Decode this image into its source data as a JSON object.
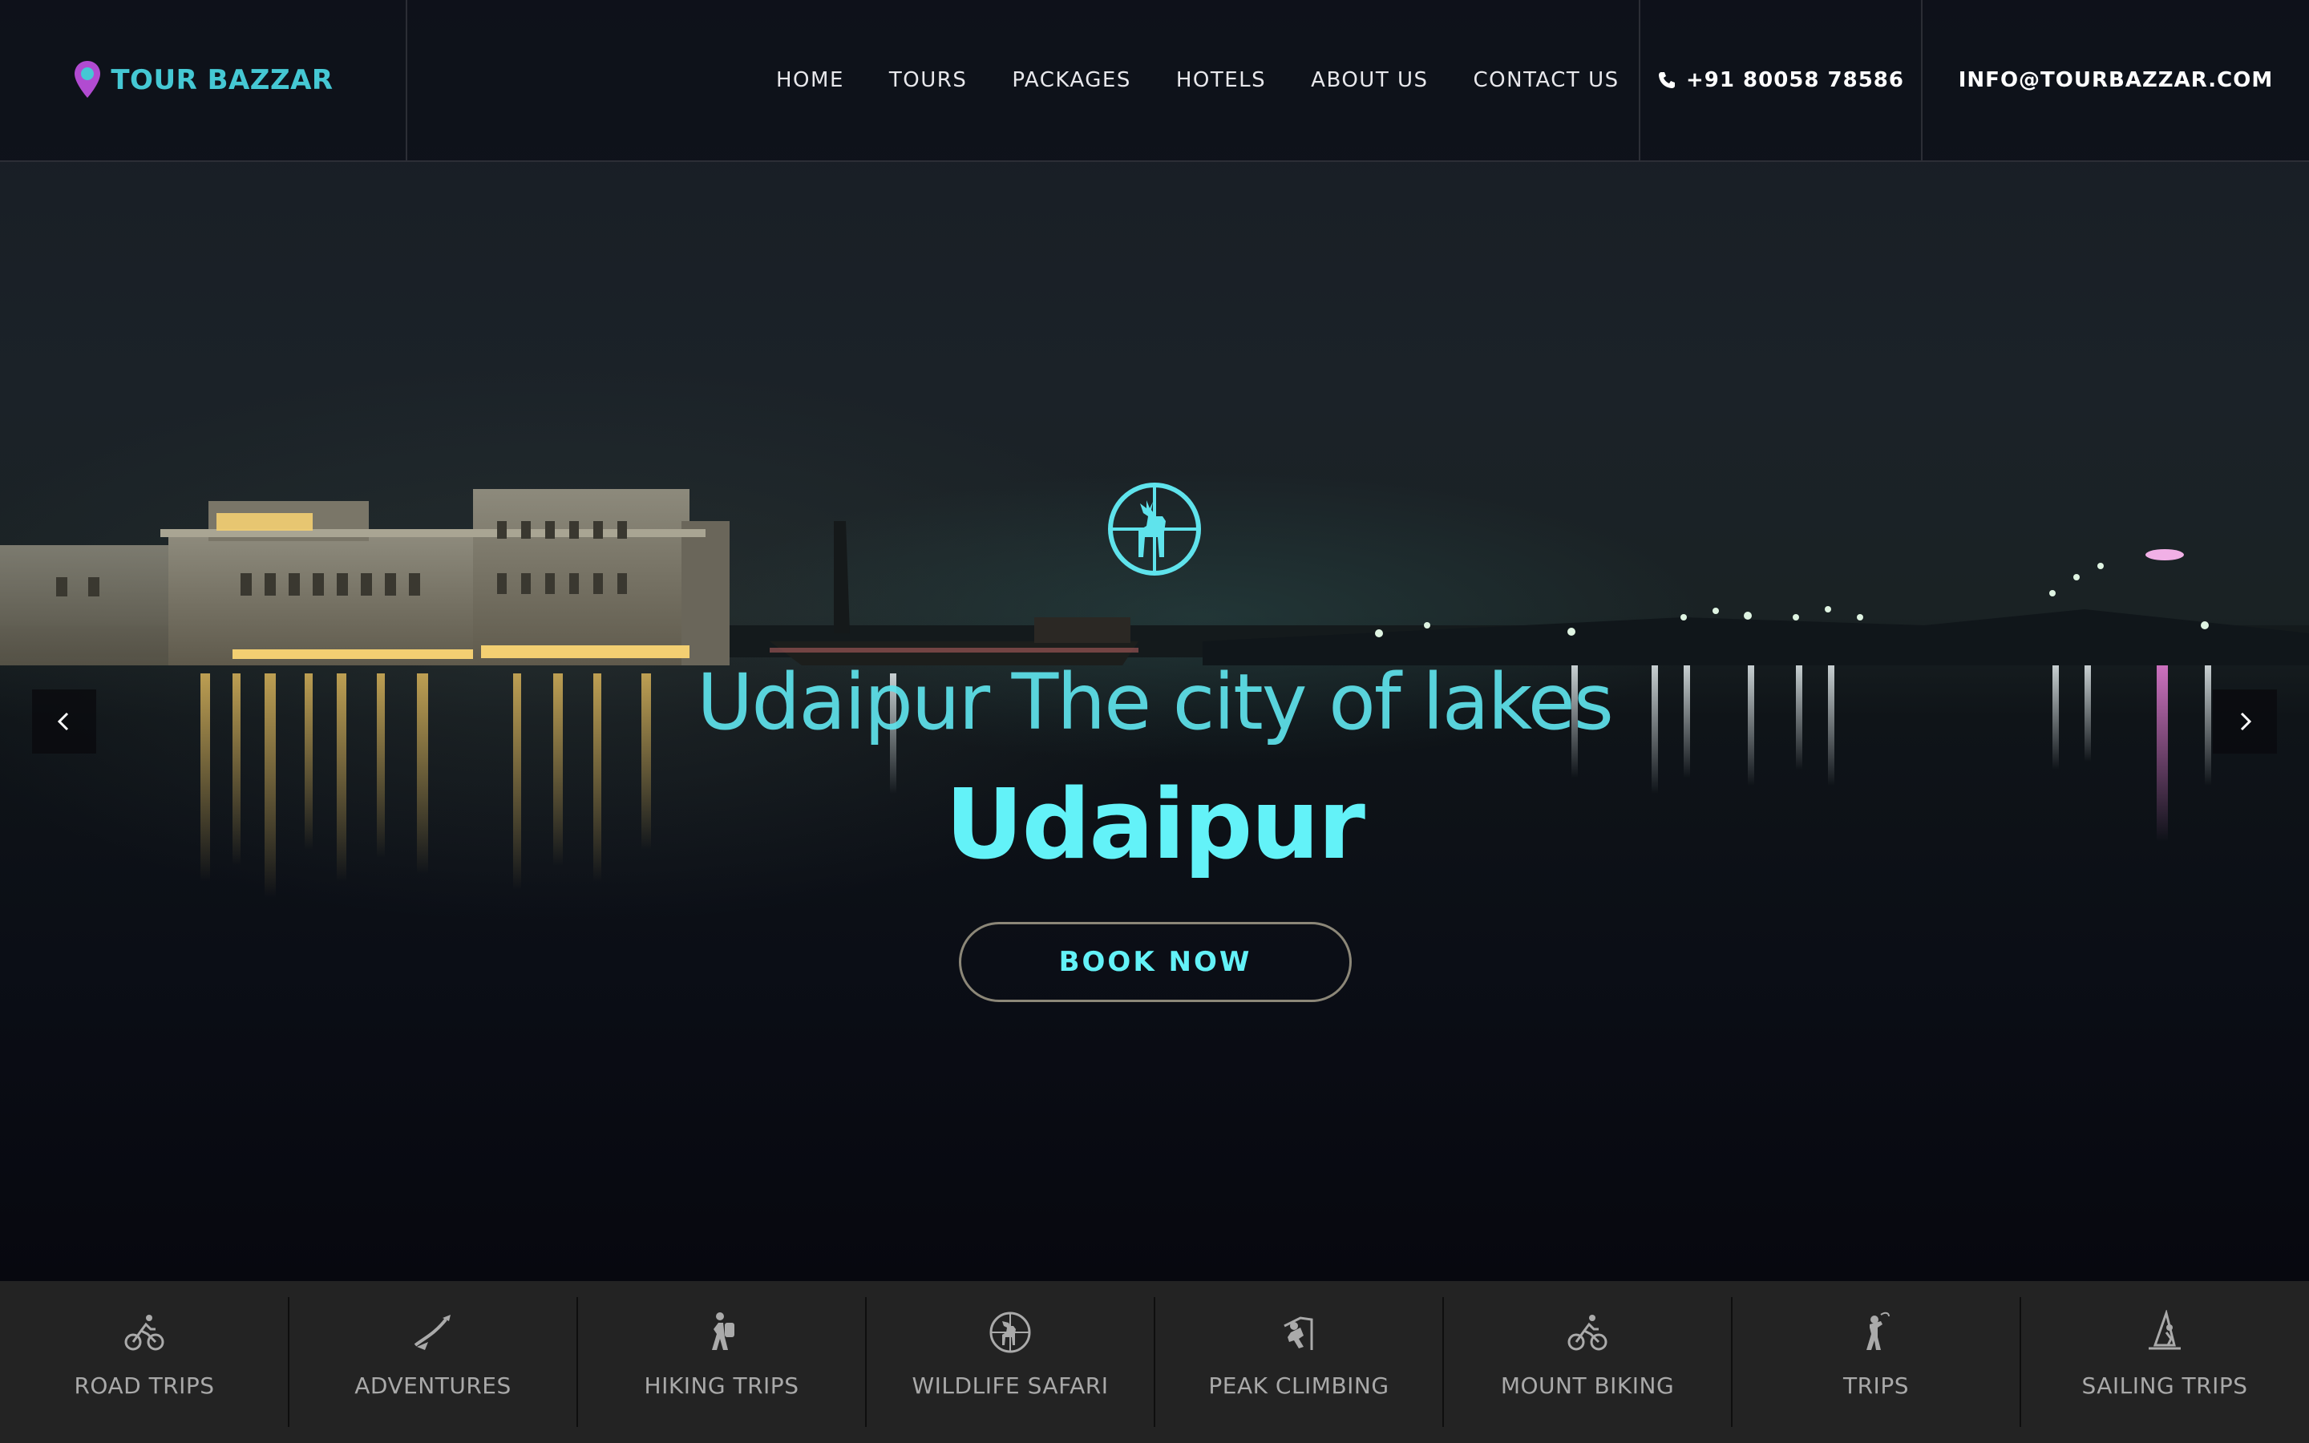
{
  "brand": {
    "name": "TOUR BAZZAR",
    "logo_icon": "map-pin-icon",
    "accent_color": "#45c8d4"
  },
  "nav": {
    "items": [
      {
        "label": "HOME"
      },
      {
        "label": "TOURS"
      },
      {
        "label": "PACKAGES"
      },
      {
        "label": "HOTELS"
      },
      {
        "label": "ABOUT US"
      },
      {
        "label": "CONTACT US"
      }
    ]
  },
  "contact": {
    "phone_icon": "phone-icon",
    "phone": "+91 80058 78586",
    "email": "INFO@TOURBAZZAR.COM"
  },
  "hero": {
    "emblem_icon": "deer-crosshair-icon",
    "subtitle": "Udaipur The city of lakes",
    "title": "Udaipur",
    "cta_label": "BOOK NOW",
    "prev_icon": "chevron-left-icon",
    "next_icon": "chevron-right-icon",
    "text_color": "#63f2f8"
  },
  "categories": [
    {
      "label": "ROAD TRIPS",
      "icon": "cyclist-icon"
    },
    {
      "label": "ADVENTURES",
      "icon": "canoe-icon"
    },
    {
      "label": "HIKING TRIPS",
      "icon": "hiker-icon"
    },
    {
      "label": "WILDLIFE SAFARI",
      "icon": "deer-crosshair-icon"
    },
    {
      "label": "PEAK CLIMBING",
      "icon": "climber-icon"
    },
    {
      "label": "MOUNT BIKING",
      "icon": "cyclist-icon"
    },
    {
      "label": "TRIPS",
      "icon": "golfer-icon"
    },
    {
      "label": "SAILING TRIPS",
      "icon": "windsurf-icon"
    }
  ]
}
